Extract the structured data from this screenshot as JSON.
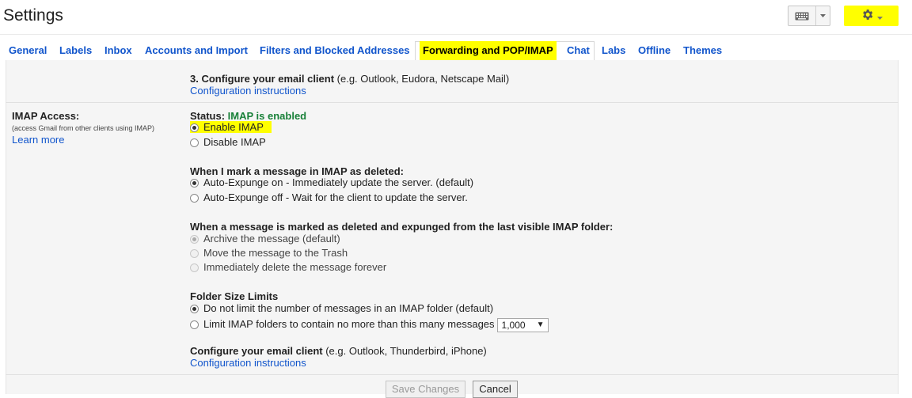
{
  "header": {
    "title": "Settings"
  },
  "tabs": [
    {
      "label": "General"
    },
    {
      "label": "Labels"
    },
    {
      "label": "Inbox"
    },
    {
      "label": "Accounts and Import"
    },
    {
      "label": "Filters and Blocked Addresses"
    },
    {
      "label": "Forwarding and POP/IMAP",
      "active": true
    },
    {
      "label": "Chat"
    },
    {
      "label": "Labs"
    },
    {
      "label": "Offline"
    },
    {
      "label": "Themes"
    }
  ],
  "pop_section": {
    "step3_bold": "3. Configure your email client",
    "step3_rest": " (e.g. Outlook, Eudora, Netscape Mail)",
    "config_link": "Configuration instructions"
  },
  "imap": {
    "label": "IMAP Access:",
    "sublabel": "(access Gmail from other clients using IMAP)",
    "learn_more": "Learn more",
    "status_prefix": "Status: ",
    "status_value": "IMAP is enabled",
    "enable": "Enable IMAP",
    "disable": "Disable IMAP",
    "deleted_heading": "When I mark a message in IMAP as deleted:",
    "expunge_on": "Auto-Expunge on - Immediately update the server. (default)",
    "expunge_off": "Auto-Expunge off - Wait for the client to update the server.",
    "expunged_heading": "When a message is marked as deleted and expunged from the last visible IMAP folder:",
    "archive": "Archive the message (default)",
    "trash": "Move the message to the Trash",
    "delete_forever": "Immediately delete the message forever",
    "folder_heading": "Folder Size Limits",
    "no_limit": "Do not limit the number of messages in an IMAP folder (default)",
    "limit": "Limit IMAP folders to contain no more than this many messages",
    "limit_value": "1,000",
    "client_bold": "Configure your email client",
    "client_rest": " (e.g. Outlook, Thunderbird, iPhone)",
    "client_link": "Configuration instructions"
  },
  "footer": {
    "save": "Save Changes",
    "cancel": "Cancel"
  },
  "colors": {
    "highlight": "#ffff00",
    "link": "#1155cc",
    "status_green": "#188038"
  }
}
